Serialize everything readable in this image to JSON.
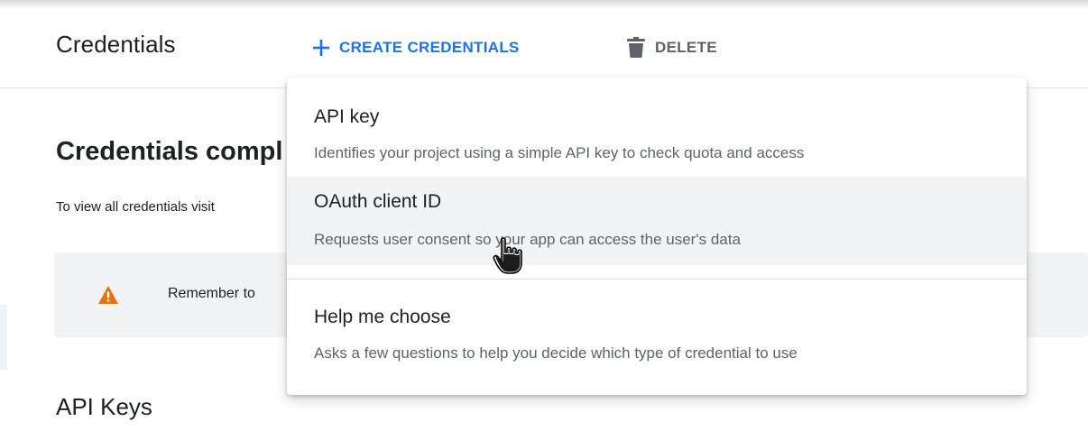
{
  "toolbar": {
    "title": "Credentials",
    "create_label": "CREATE CREDENTIALS",
    "create_icon": "plus-icon",
    "delete_label": "DELETE",
    "delete_icon": "trash-icon"
  },
  "main": {
    "section_title": "Credentials compl",
    "section_desc": "To view all credentials visit",
    "notice": {
      "icon": "warning-icon",
      "text": "Remember to"
    },
    "api_keys_title": "API Keys"
  },
  "menu": {
    "items": [
      {
        "title": "API key",
        "description": "Identifies your project using a simple API key to check quota and access"
      },
      {
        "title": "OAuth client ID",
        "description": "Requests user consent so your app can access the user's data"
      },
      {
        "title": "Help me choose",
        "description": "Asks a few questions to help you decide which type of credential to use"
      }
    ]
  },
  "colors": {
    "accent": "#1a73e8",
    "warning": "#e8710a",
    "text_primary": "#202124",
    "text_secondary": "#5f6368",
    "hover_background": "#f1f3f4"
  }
}
